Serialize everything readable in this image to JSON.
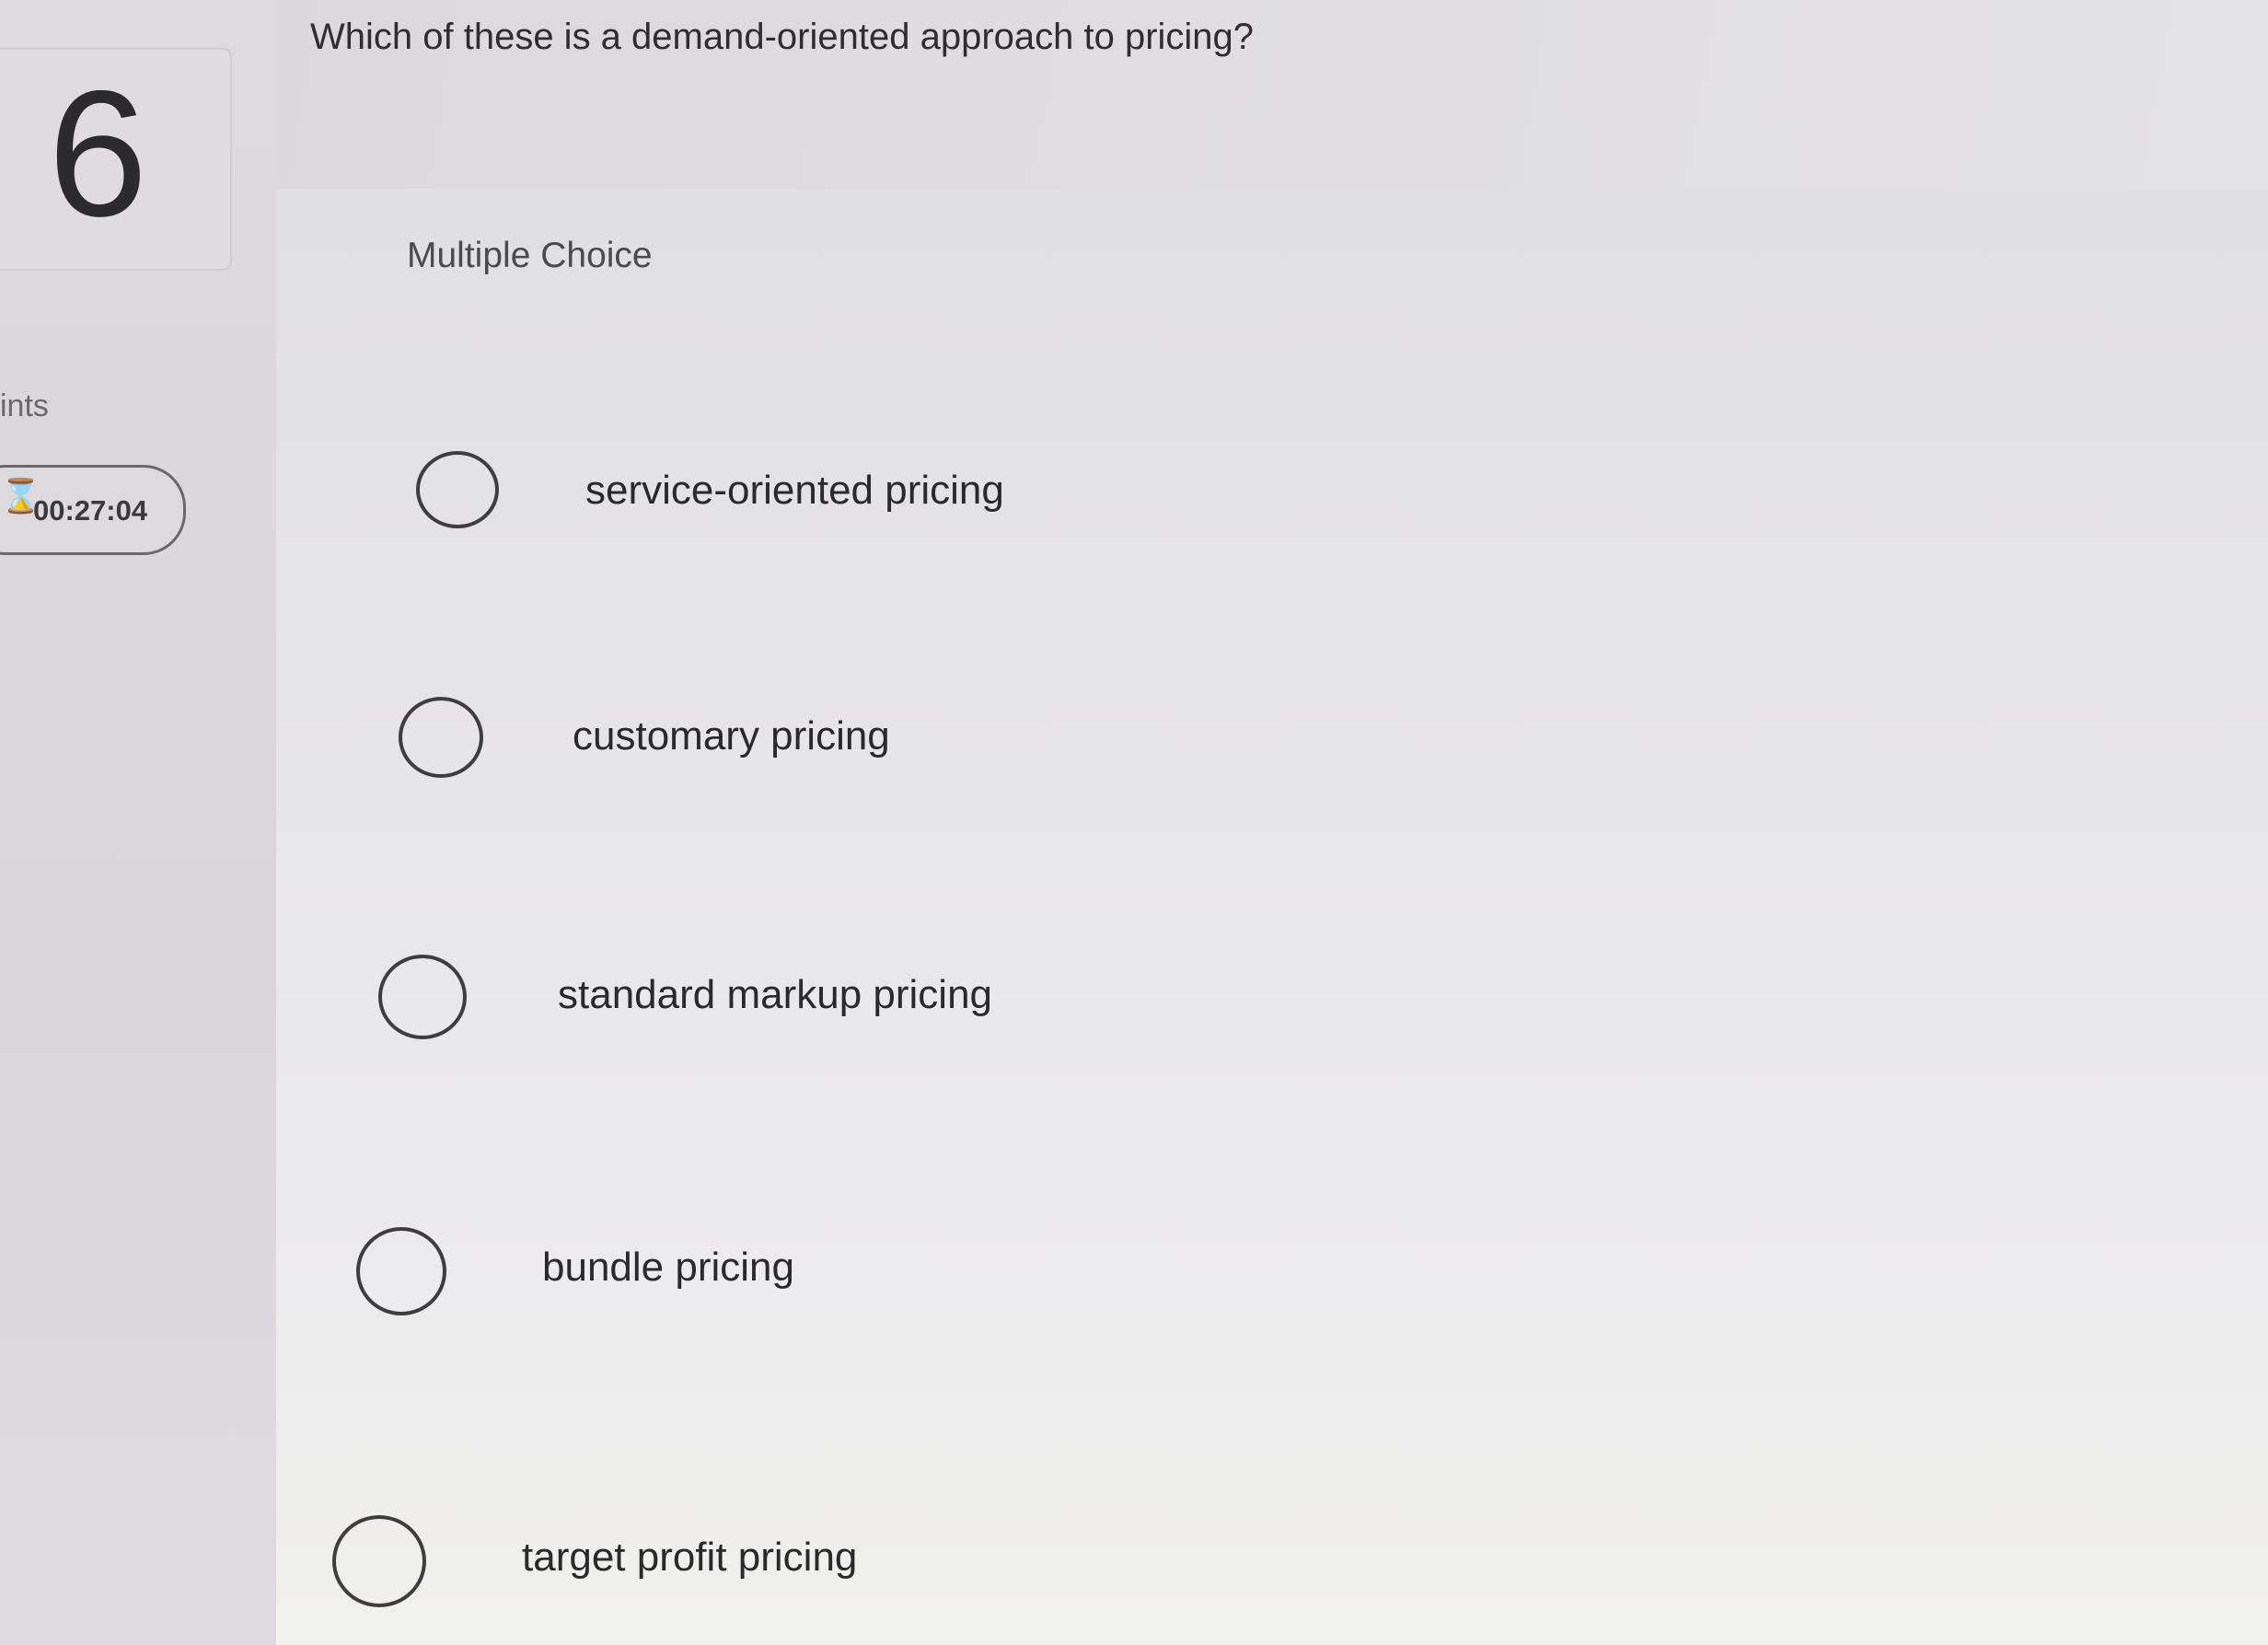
{
  "question": {
    "number": "6",
    "text": "Which of these is a demand-oriented approach to pricing?",
    "points_label": "ints",
    "timer": "00:27:04",
    "timer_icon": "clock-icon"
  },
  "answer_section": {
    "label": "Multiple Choice",
    "options": [
      {
        "label": "service-oriented pricing",
        "selected": false
      },
      {
        "label": "customary pricing",
        "selected": false
      },
      {
        "label": "standard markup pricing",
        "selected": false
      },
      {
        "label": "bundle pricing",
        "selected": false
      },
      {
        "label": "target profit pricing",
        "selected": false
      }
    ]
  }
}
